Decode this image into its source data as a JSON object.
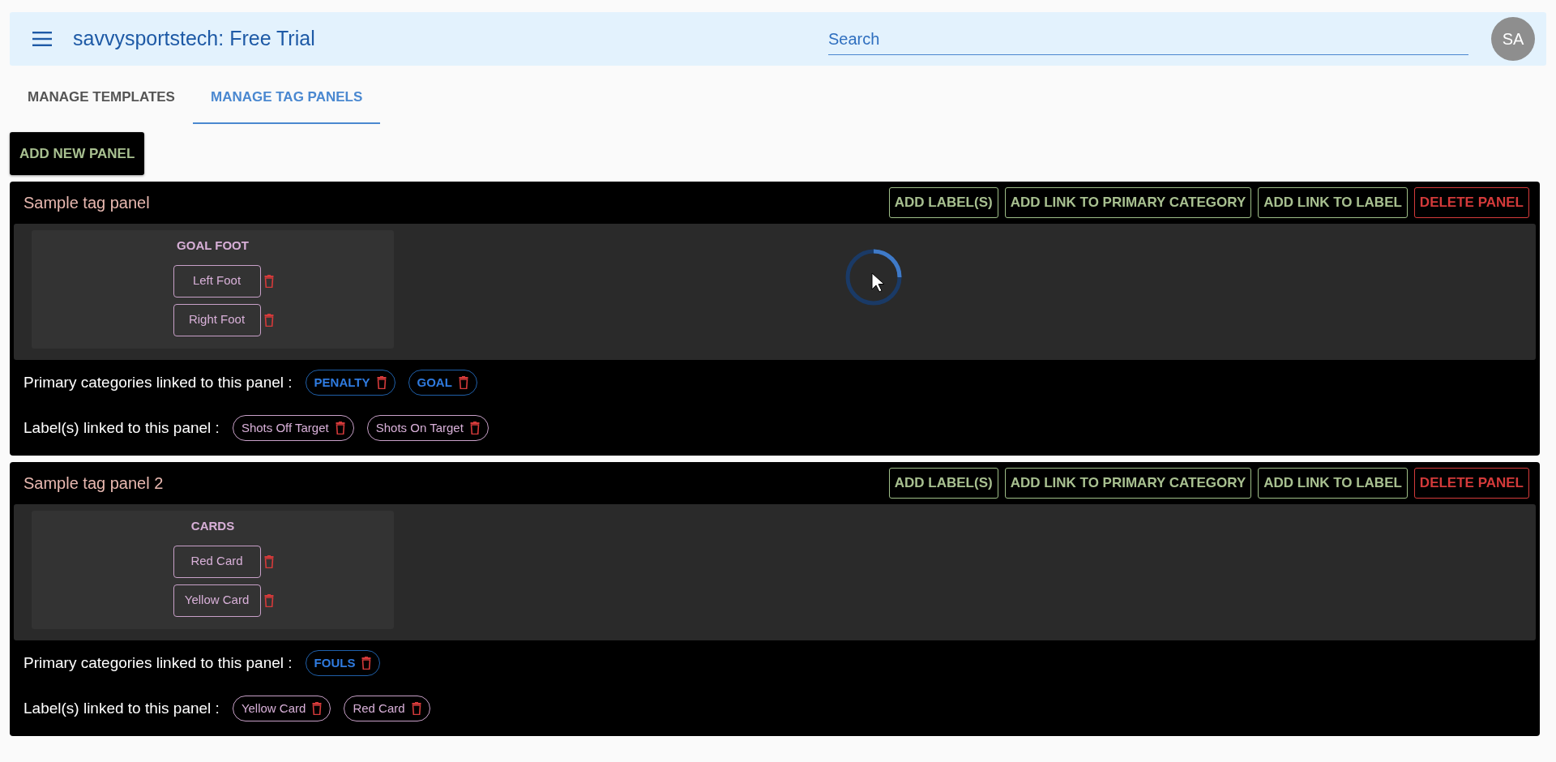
{
  "app_bar": {
    "title": "savvysportstech: Free Trial",
    "search": {
      "placeholder": "Search"
    },
    "avatar": "SA"
  },
  "tabs": [
    {
      "label": "MANAGE TEMPLATES",
      "selected": false
    },
    {
      "label": "MANAGE TAG PANELS",
      "selected": true
    }
  ],
  "add_panel_button": "ADD NEW PANEL",
  "panels": [
    {
      "title": "Sample tag panel",
      "loading": true,
      "actions": [
        {
          "label": "ADD LABEL(S)",
          "kind": "normal"
        },
        {
          "label": "ADD LINK TO PRIMARY CATEGORY",
          "kind": "normal"
        },
        {
          "label": "ADD LINK TO LABEL",
          "kind": "normal"
        },
        {
          "label": "DELETE PANEL",
          "kind": "danger"
        }
      ],
      "groups": [
        {
          "title": "GOAL FOOT",
          "labels": [
            "Left Foot",
            "Right Foot"
          ]
        }
      ],
      "primary_caption": "Primary categories linked to this panel :",
      "primary_categories": [
        "PENALTY",
        "GOAL"
      ],
      "labels_caption": "Label(s) linked to this panel :",
      "linked_labels": [
        "Shots Off Target",
        "Shots On Target"
      ]
    },
    {
      "title": "Sample tag panel 2",
      "loading": false,
      "actions": [
        {
          "label": "ADD LABEL(S)",
          "kind": "normal"
        },
        {
          "label": "ADD LINK TO PRIMARY CATEGORY",
          "kind": "normal"
        },
        {
          "label": "ADD LINK TO LABEL",
          "kind": "normal"
        },
        {
          "label": "DELETE PANEL",
          "kind": "danger"
        }
      ],
      "groups": [
        {
          "title": "CARDS",
          "labels": [
            "Red Card",
            "Yellow Card"
          ]
        }
      ],
      "primary_caption": "Primary categories linked to this panel :",
      "primary_categories": [
        "FOULS"
      ],
      "labels_caption": "Label(s) linked to this panel :",
      "linked_labels": [
        "Yellow Card",
        "Red Card"
      ]
    }
  ]
}
